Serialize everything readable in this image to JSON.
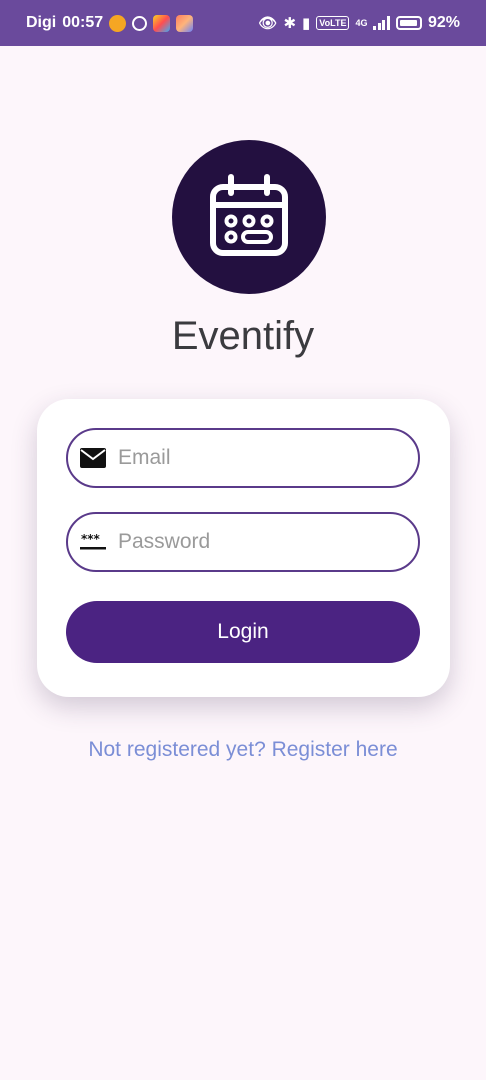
{
  "status_bar": {
    "carrier": "Digi",
    "time": "00:57",
    "network": "4G",
    "volte": "VoLTE",
    "battery": "92%"
  },
  "app": {
    "title": "Eventify",
    "logo_icon": "calendar-icon",
    "logo_bg": "#231040"
  },
  "login_form": {
    "email_placeholder": "Email",
    "email_icon": "envelope-icon",
    "password_placeholder": "Password",
    "password_icon": "password-dots-icon",
    "login_label": "Login",
    "button_color": "#4b2382",
    "field_border_color": "#5a3a8a"
  },
  "register_link": "Not registered yet? Register here",
  "colors": {
    "status_bar": "#6a4a9c",
    "background": "#fdf6fb",
    "link": "#7b8ed6"
  }
}
